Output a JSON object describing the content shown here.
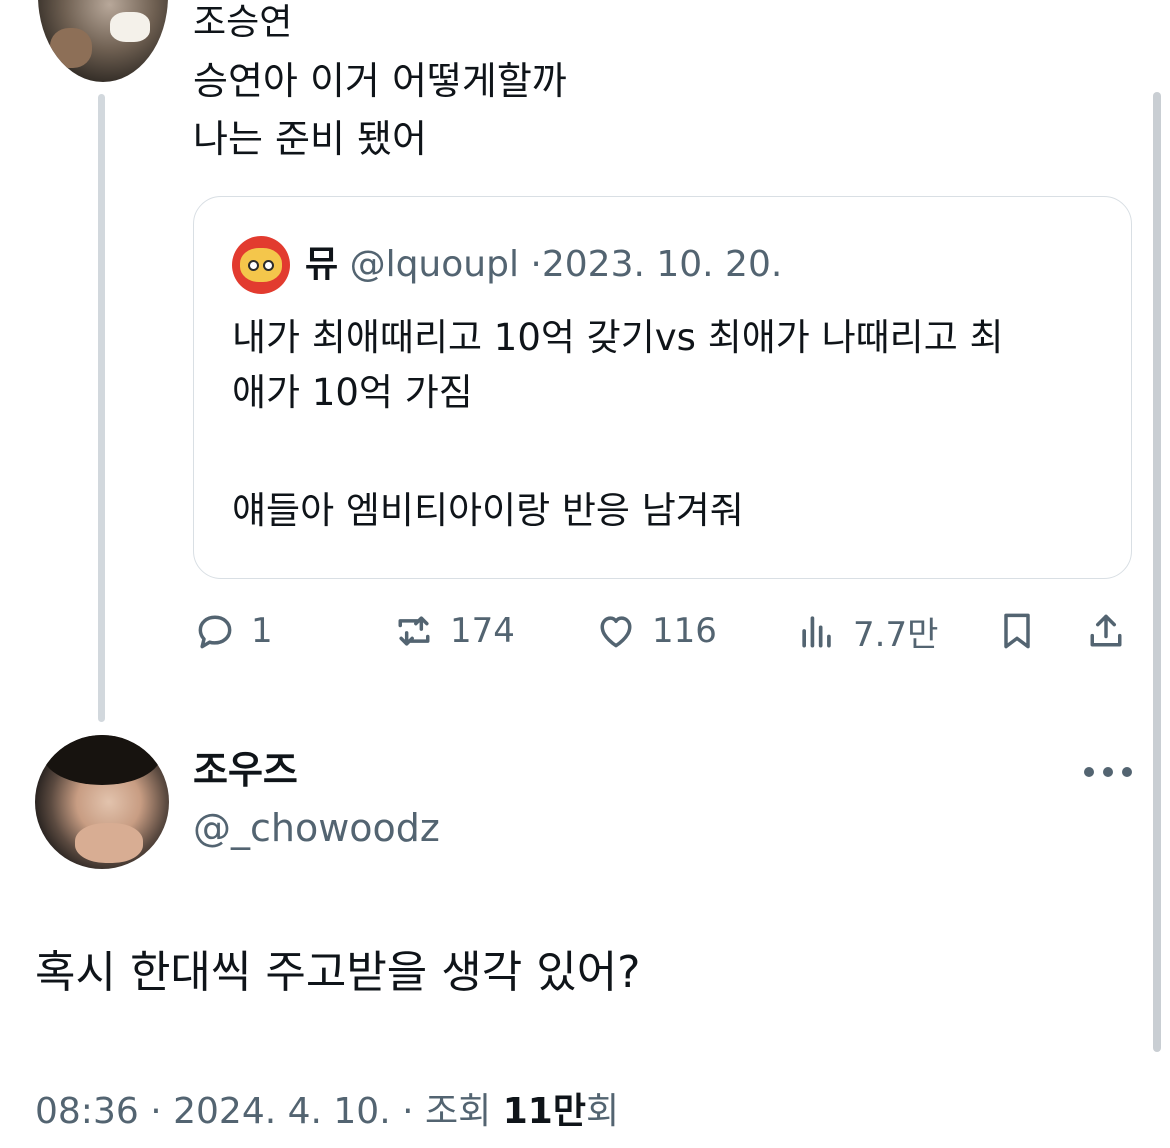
{
  "top_tweet": {
    "name": "조승연",
    "lines": [
      "승연아 이거 어떻게할까",
      "나는 준비 됐어"
    ]
  },
  "quote": {
    "name": "뮤",
    "handle": "@lquoupl",
    "separator": "·",
    "date": "2023. 10. 20.",
    "lines": [
      "내가 최애때리고 10억 갖기vs 최애가 나때리고 최",
      "애가 10억 가짐",
      "얘들아 엠비티아이랑 반응 남겨줘"
    ]
  },
  "actions": {
    "reply_count": "1",
    "retweet_count": "174",
    "like_count": "116",
    "view_count": "7.7만",
    "icons": [
      "reply-icon",
      "retweet-icon",
      "heart-icon",
      "views-icon",
      "bookmark-icon",
      "share-icon"
    ]
  },
  "main_tweet": {
    "name": "조우즈",
    "handle": "@_chowoodz",
    "text": "혹시 한대씩 주고받을 생각 있어?",
    "time": "08:36",
    "separator": "·",
    "date": "2024. 4. 10.",
    "views_label": "조회",
    "views_value": "11만",
    "views_suffix": "회"
  },
  "colors": {
    "text": "#0f1419",
    "secondary": "#536471",
    "border": "#d9dfe4",
    "thread_line": "#d2d8dd"
  }
}
